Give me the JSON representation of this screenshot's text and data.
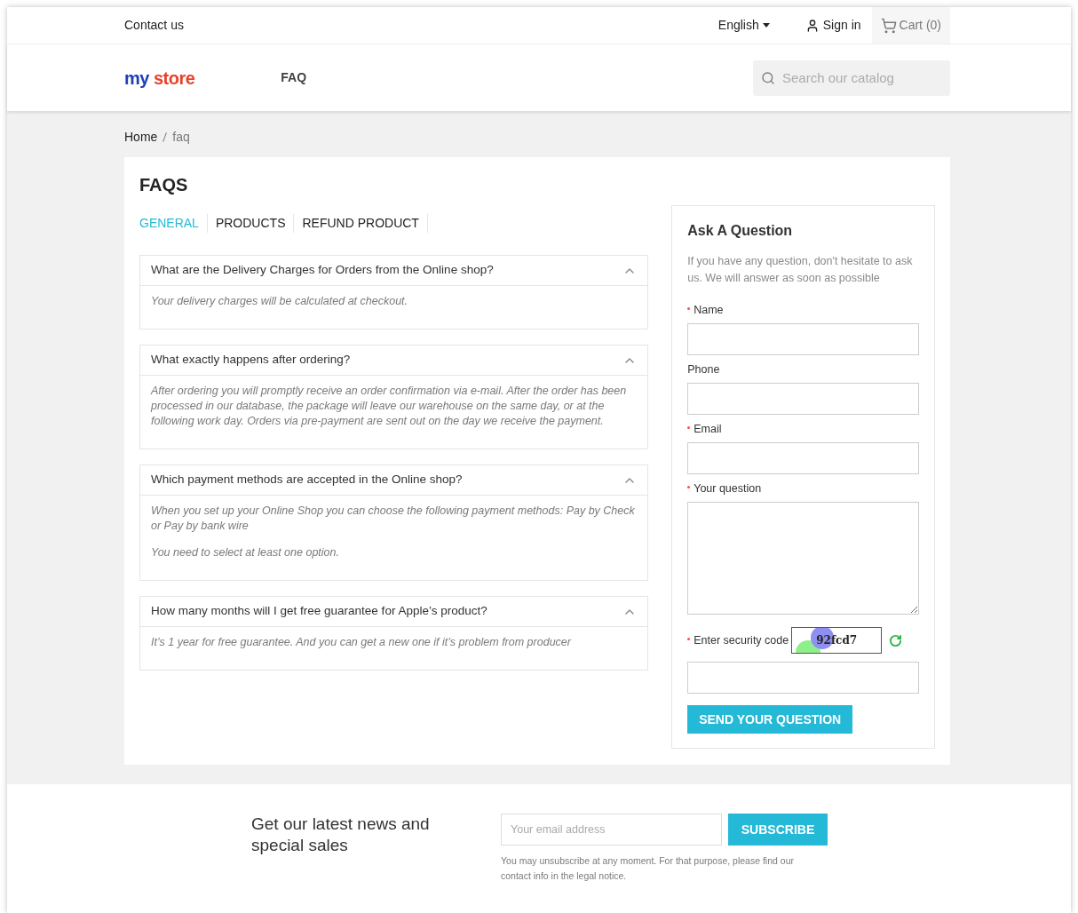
{
  "top_bar": {
    "contact": "Contact us",
    "language": "English",
    "sign_in": "Sign in",
    "cart": "Cart (0)"
  },
  "header": {
    "logo_words": [
      "my",
      "store"
    ],
    "nav": [
      "FAQ"
    ],
    "search": {
      "placeholder": "Search our catalog"
    }
  },
  "breadcrumb": [
    "Home",
    "faq"
  ],
  "faq": {
    "title": "FAQS",
    "tabs": [
      {
        "label": "GENERAL",
        "selected": true
      },
      {
        "label": "PRODUCTS",
        "selected": false
      },
      {
        "label": "REFUND PRODUCT",
        "selected": false
      }
    ],
    "items": [
      {
        "question": "What are the Delivery Charges for Orders from the Online shop?",
        "expanded": true,
        "answer": [
          "Your delivery charges will be calculated at checkout."
        ]
      },
      {
        "question": "What exactly happens after ordering?",
        "expanded": true,
        "answer": [
          "After ordering you will promptly receive an order confirmation via e-mail. After the order has been processed in our database, the package will leave our warehouse on the same day, or at the following work day. Orders via pre-payment are sent out on the day we receive the payment."
        ]
      },
      {
        "question": "Which payment methods are accepted in the Online shop?",
        "expanded": true,
        "answer": [
          "When you set up your Online Shop you can choose the following payment methods: Pay by Check or Pay by bank wire",
          "You need to select at least one option."
        ]
      },
      {
        "question": "How many months will I get free guarantee for Apple’s product?",
        "expanded": true,
        "answer": [
          "It’s 1 year for free guarantee. And you can get a new one if it’s problem from producer"
        ]
      }
    ]
  },
  "ask": {
    "title": "Ask A Question",
    "intro": "If you have any question, don't hesitate to ask us. We will answer as soon as possible",
    "fields": [
      {
        "label": "Name",
        "required": true,
        "kind": "input"
      },
      {
        "label": "Phone",
        "required": false,
        "kind": "input"
      },
      {
        "label": "Email",
        "required": true,
        "kind": "input"
      },
      {
        "label": "Your question",
        "required": true,
        "kind": "textarea"
      }
    ],
    "captcha": {
      "label": "Enter security code",
      "required": true,
      "code": "92fcd7"
    },
    "submit": "SEND YOUR QUESTION"
  },
  "newsletter": {
    "heading": "Get our latest news and special sales",
    "email": {
      "placeholder": "Your email address"
    },
    "button": "SUBSCRIBE",
    "note": "You may unsubscribe at any moment. For that purpose, please find our contact info in the legal notice."
  }
}
